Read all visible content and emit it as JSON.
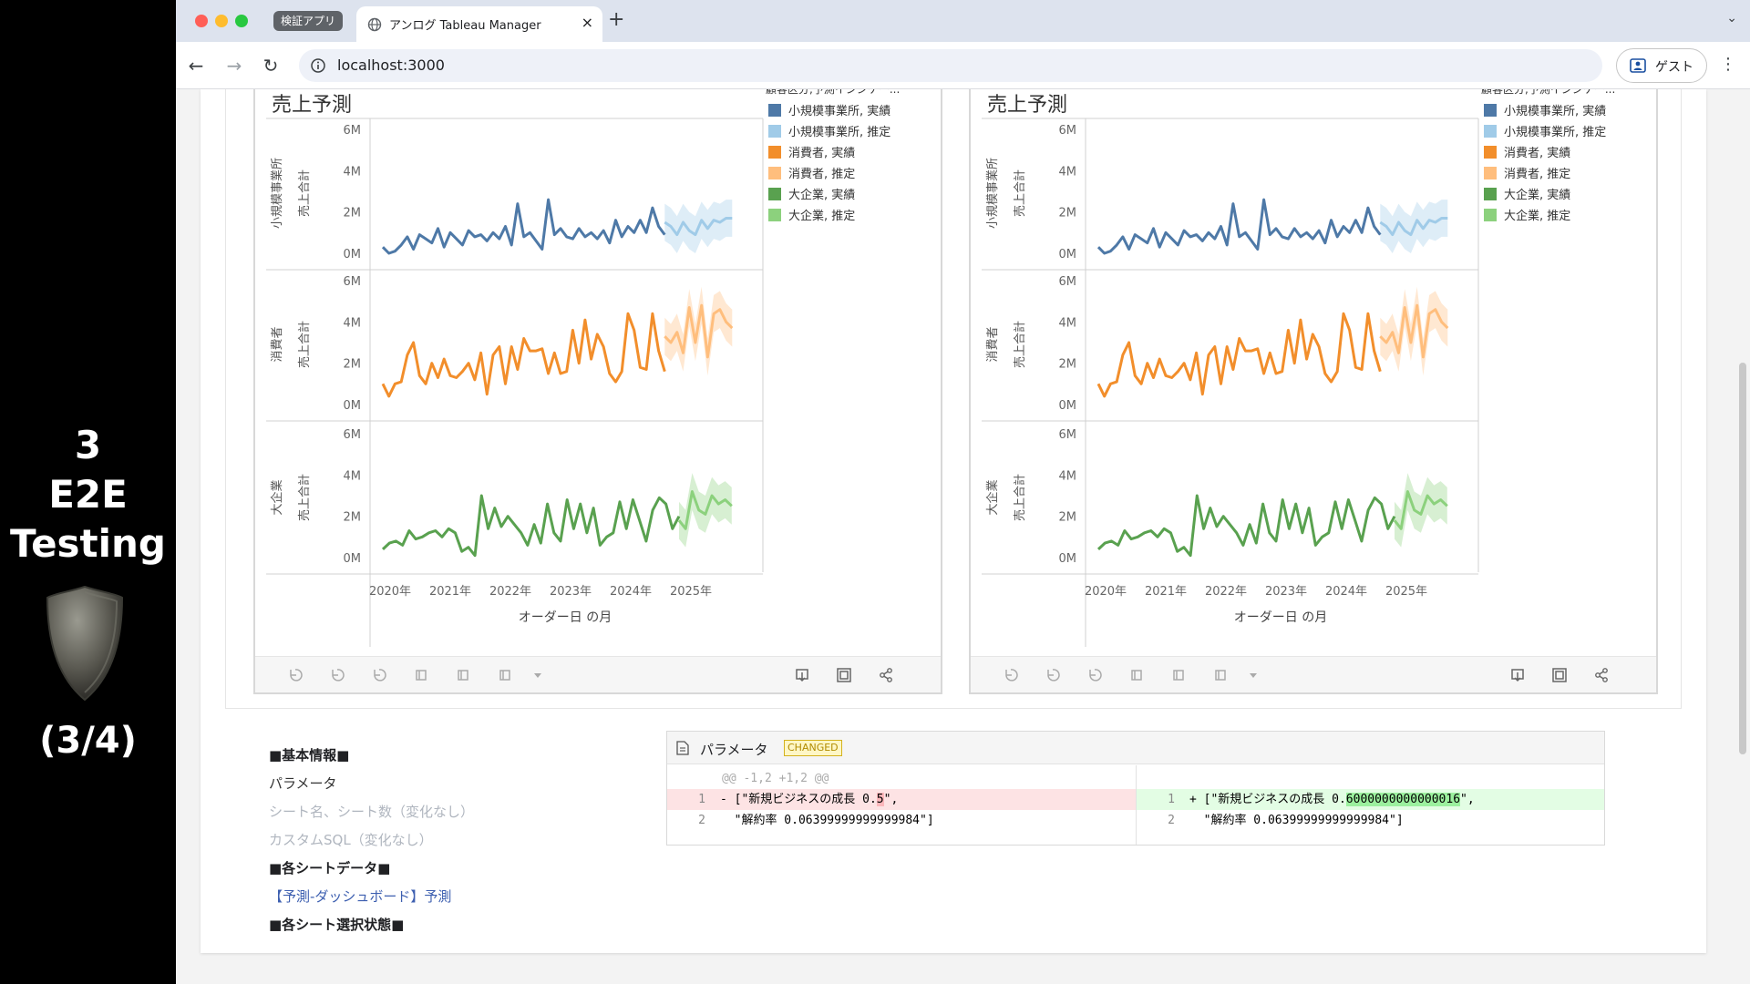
{
  "side": {
    "line1": "3",
    "line2": "E2E",
    "line3": "Testing",
    "progress": "(3/4)"
  },
  "browser": {
    "tab_group": "検証アプリ",
    "tab_title": "アンログ Tableau Manager",
    "tab_close": "×",
    "new_tab": "+",
    "url": "localhost:3000",
    "profile": "ゲスト"
  },
  "chart_data": [
    {
      "type": "line",
      "title": "売上予測",
      "legend_title": "顧客区分,予測インジケー...",
      "legend": [
        "小規模事業所, 実績",
        "小規模事業所, 推定",
        "消費者, 実績",
        "消費者, 推定",
        "大企業, 実績",
        "大企業, 推定"
      ],
      "rows": [
        {
          "label1": "小規模事業所",
          "label2": "売上合計",
          "color": "#4e79a7",
          "est_color": "#a0cbe8"
        },
        {
          "label1": "消費者",
          "label2": "売上合計",
          "color": "#f28e2b",
          "est_color": "#ffbe7d"
        },
        {
          "label1": "大企業",
          "label2": "売上合計",
          "color": "#59a14f",
          "est_color": "#8cd17d"
        }
      ],
      "y_ticks": [
        "6M",
        "4M",
        "2M",
        "0M"
      ],
      "ylim": [
        0,
        6
      ],
      "x_ticks": [
        "2020年",
        "2021年",
        "2022年",
        "2023年",
        "2024年",
        "2025年"
      ],
      "xlabel": "オーダー日 の月",
      "series": [
        {
          "name": "小規模事業所, 実績",
          "values": [
            0.3,
            0.0,
            0.1,
            0.4,
            0.8,
            0.2,
            0.9,
            0.7,
            0.5,
            1.2,
            0.3,
            1.0,
            0.7,
            0.4,
            1.1,
            0.8,
            0.9,
            0.6,
            1.0,
            0.7,
            1.3,
            0.4,
            2.4,
            0.8,
            1.0,
            0.6,
            0.2,
            2.6,
            0.9,
            1.2,
            0.8,
            0.7,
            1.2,
            0.8,
            1.0,
            0.7,
            1.1,
            0.5,
            1.6,
            0.8,
            1.3,
            1.0,
            1.6,
            1.0,
            2.2,
            1.3,
            0.9
          ]
        },
        {
          "name": "小規模事業所, 推定",
          "values": [
            1.5,
            1.3,
            0.9,
            1.5,
            1.1,
            0.9,
            1.6,
            1.2,
            1.6,
            1.5,
            1.7,
            1.7
          ]
        },
        {
          "name": "消費者, 実績",
          "values": [
            1.0,
            0.4,
            1.0,
            1.1,
            2.4,
            3.0,
            1.4,
            1.0,
            2.0,
            1.3,
            2.2,
            1.4,
            1.3,
            1.6,
            2.0,
            1.2,
            2.5,
            0.5,
            2.4,
            2.8,
            1.0,
            2.8,
            1.7,
            3.2,
            2.6,
            2.6,
            2.7,
            1.5,
            2.5,
            1.5,
            1.6,
            3.6,
            2.0,
            4.1,
            2.2,
            3.4,
            2.8,
            1.5,
            1.1,
            1.6,
            4.4,
            3.6,
            1.8,
            1.7,
            4.4,
            2.6,
            1.6
          ]
        },
        {
          "name": "消費者, 推定",
          "values": [
            3.3,
            3.0,
            3.5,
            2.5,
            4.7,
            3.0,
            4.8,
            2.3,
            4.4,
            4.6,
            4.0,
            3.7
          ]
        },
        {
          "name": "大企業, 実績",
          "values": [
            0.4,
            0.7,
            0.8,
            0.6,
            1.3,
            0.9,
            1.0,
            1.2,
            1.3,
            1.0,
            1.4,
            1.2,
            0.3,
            0.5,
            0.1,
            3.0,
            1.4,
            2.4,
            1.5,
            2.0,
            1.6,
            1.2,
            0.6,
            1.6,
            0.7,
            2.6,
            1.2,
            0.8,
            2.8,
            1.4,
            2.6,
            1.2,
            2.4,
            0.6,
            1.0,
            1.2,
            2.7,
            1.4,
            2.8,
            1.8,
            0.8,
            2.3,
            2.9,
            2.6,
            1.4,
            2.0
          ]
        },
        {
          "name": "大企業, 推定",
          "values": [
            1.8,
            1.4,
            3.2,
            2.3,
            2.1,
            3.0,
            2.6,
            2.8,
            2.5
          ]
        }
      ]
    }
  ],
  "info": {
    "basic": "■基本情報■",
    "params": "パラメータ",
    "sheets_nochange": "シート名、シート数（変化なし）",
    "sql_nochange": "カスタムSQL（変化なし）",
    "sheet_data": "■各シートデータ■",
    "sheet_link": "【予測-ダッシュボード】予測",
    "sheet_select": "■各シート選択状態■"
  },
  "diff": {
    "title": "パラメータ",
    "badge": "CHANGED",
    "hunk": "@@ -1,2 +1,2 @@",
    "left1_ln": "1",
    "left1_pre": "- [\"新規ビジネスの成長 0.",
    "left1_hl": "5",
    "left1_post": "\",",
    "left2_ln": "2",
    "left2": "  \"解約率 0.06399999999999984\"]",
    "right1_ln": "1",
    "right1_pre": "+ [\"新規ビジネスの成長 0.",
    "right1_hl": "6000000000000016",
    "right1_post": "\",",
    "right2_ln": "2",
    "right2": "  \"解約率 0.06399999999999984\"]"
  }
}
